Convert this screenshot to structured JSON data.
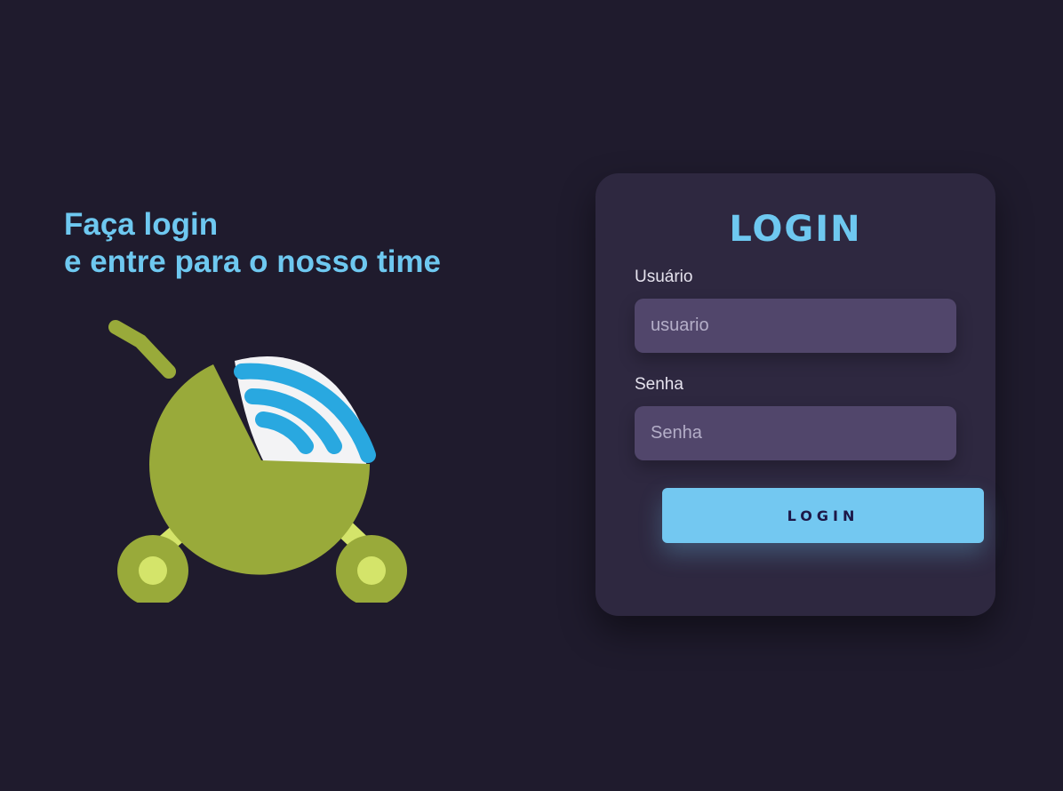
{
  "hero": {
    "line1": "Faça login",
    "line2": "e entre para o nosso time"
  },
  "logo": {
    "icon": "stroller-wifi-logo",
    "colors": {
      "body": "#99aa3a",
      "light": "#d4e46a",
      "signal": "#29a8e0",
      "hood": "#f3f3f5"
    }
  },
  "form": {
    "title": "LOGIN",
    "username": {
      "label": "Usuário",
      "placeholder": "usuario",
      "value": ""
    },
    "password": {
      "label": "Senha",
      "placeholder": "Senha",
      "value": ""
    },
    "submit_label": "LOGIN"
  },
  "colors": {
    "background": "#1f1b2d",
    "card": "#2e2840",
    "input": "#51466b",
    "accent": "#6ec8f0",
    "button_text": "#1d1747"
  }
}
